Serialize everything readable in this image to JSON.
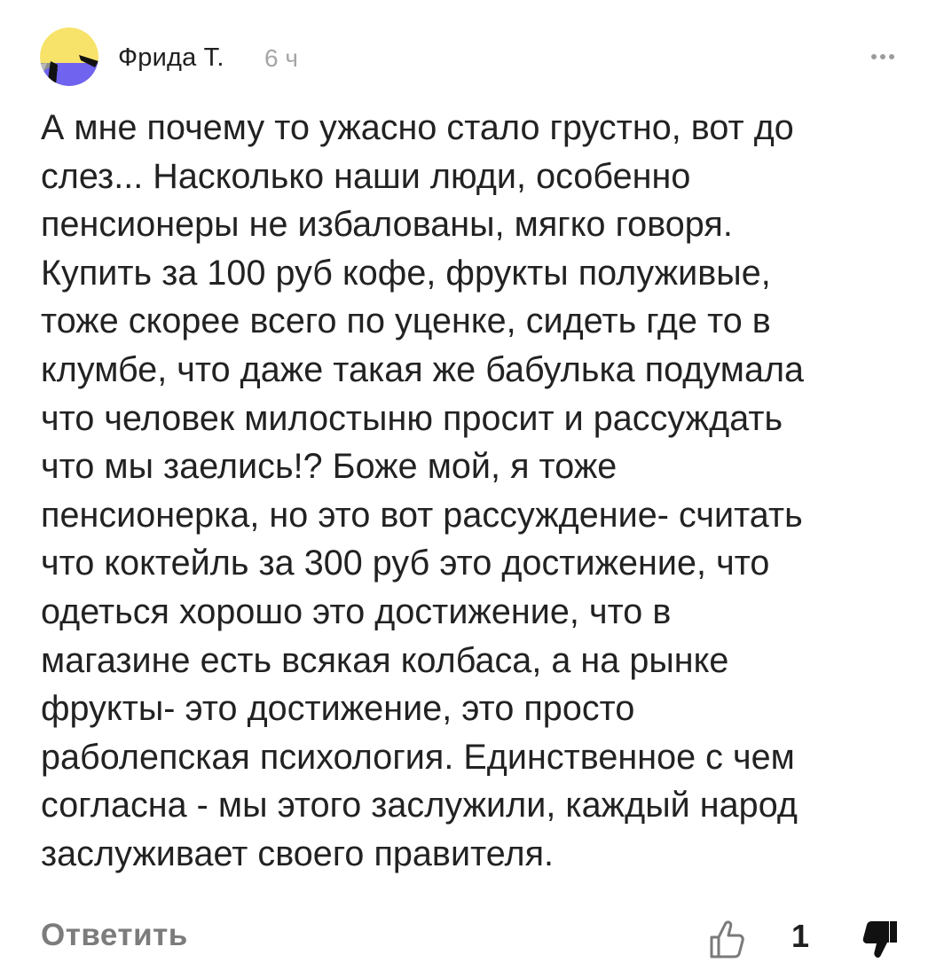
{
  "comment": {
    "author": "Фрида Т.",
    "time": "6 ч",
    "avatar_icon": "avatar-yellow-blue-icon",
    "avatar_colors": {
      "top": "#f7e36a",
      "bottom": "#6f63f0",
      "left_dark": "#111111",
      "left_gray": "#8d8d8d"
    },
    "more_icon": "more-horizontal-icon",
    "text": "А мне почему то ужасно стало грустно, вот до\nслез... Насколько наши люди, особенно\nпенсионеры не избалованы, мягко говоря.\nКупить за 100 руб кофе, фрукты полуживые,\nтоже скорее всего по уценке, сидеть где то в\nклумбе, что даже такая же бабулька подумала\nчто человек милостыню просит и рассуждать\nчто мы заелись!?   Боже мой, я тоже\nпенсионерка, но это вот рассуждение- считать\nчто коктейль за 300 руб это достижение, что\nодеться хорошо это достижение, что в\nмагазине есть всякая колбаса, а на рынке\nфрукты- это достижение, это просто\nраболепская психология.  Единственное с чем\nсогласна - мы этого заслужили, каждый народ\nзаслуживает своего правителя."
  },
  "footer": {
    "reply_label": "Ответить",
    "like_icon": "thumbs-up-outline-icon",
    "like_count": "1",
    "dislike_icon": "thumbs-down-filled-icon"
  }
}
